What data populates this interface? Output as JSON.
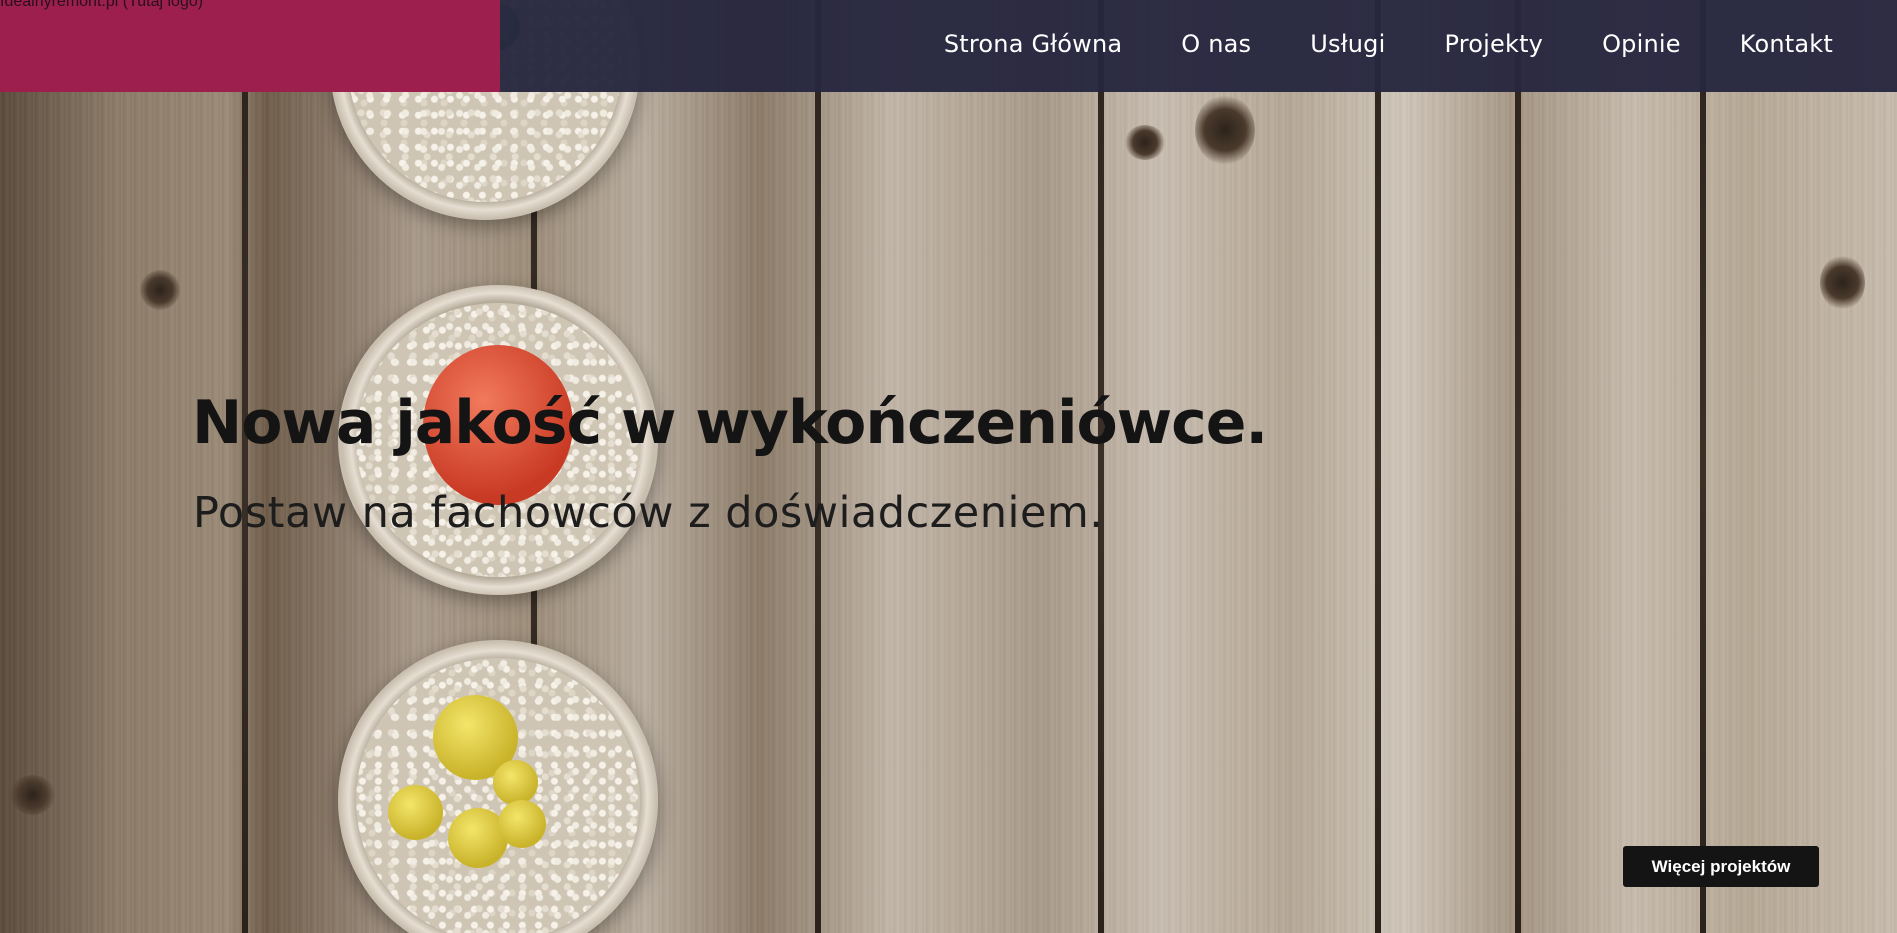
{
  "header": {
    "logo_text": "Idealnyremont.pl (Tutaj logo)",
    "brand_color": "#9c1f4e",
    "navbar_color": "#262640",
    "nav": [
      {
        "label": "Strona Główna"
      },
      {
        "label": "O nas"
      },
      {
        "label": "Usługi"
      },
      {
        "label": "Projekty"
      },
      {
        "label": "Opinie"
      },
      {
        "label": "Kontakt"
      }
    ]
  },
  "hero": {
    "headline": "Nowa jakość w wykończeniówce.",
    "subheadline": "Postaw na fachowców z doświadczeniem.",
    "cta_label": "Więcej projektów",
    "background": "wooden-planks-with-cactus-pots-image"
  }
}
